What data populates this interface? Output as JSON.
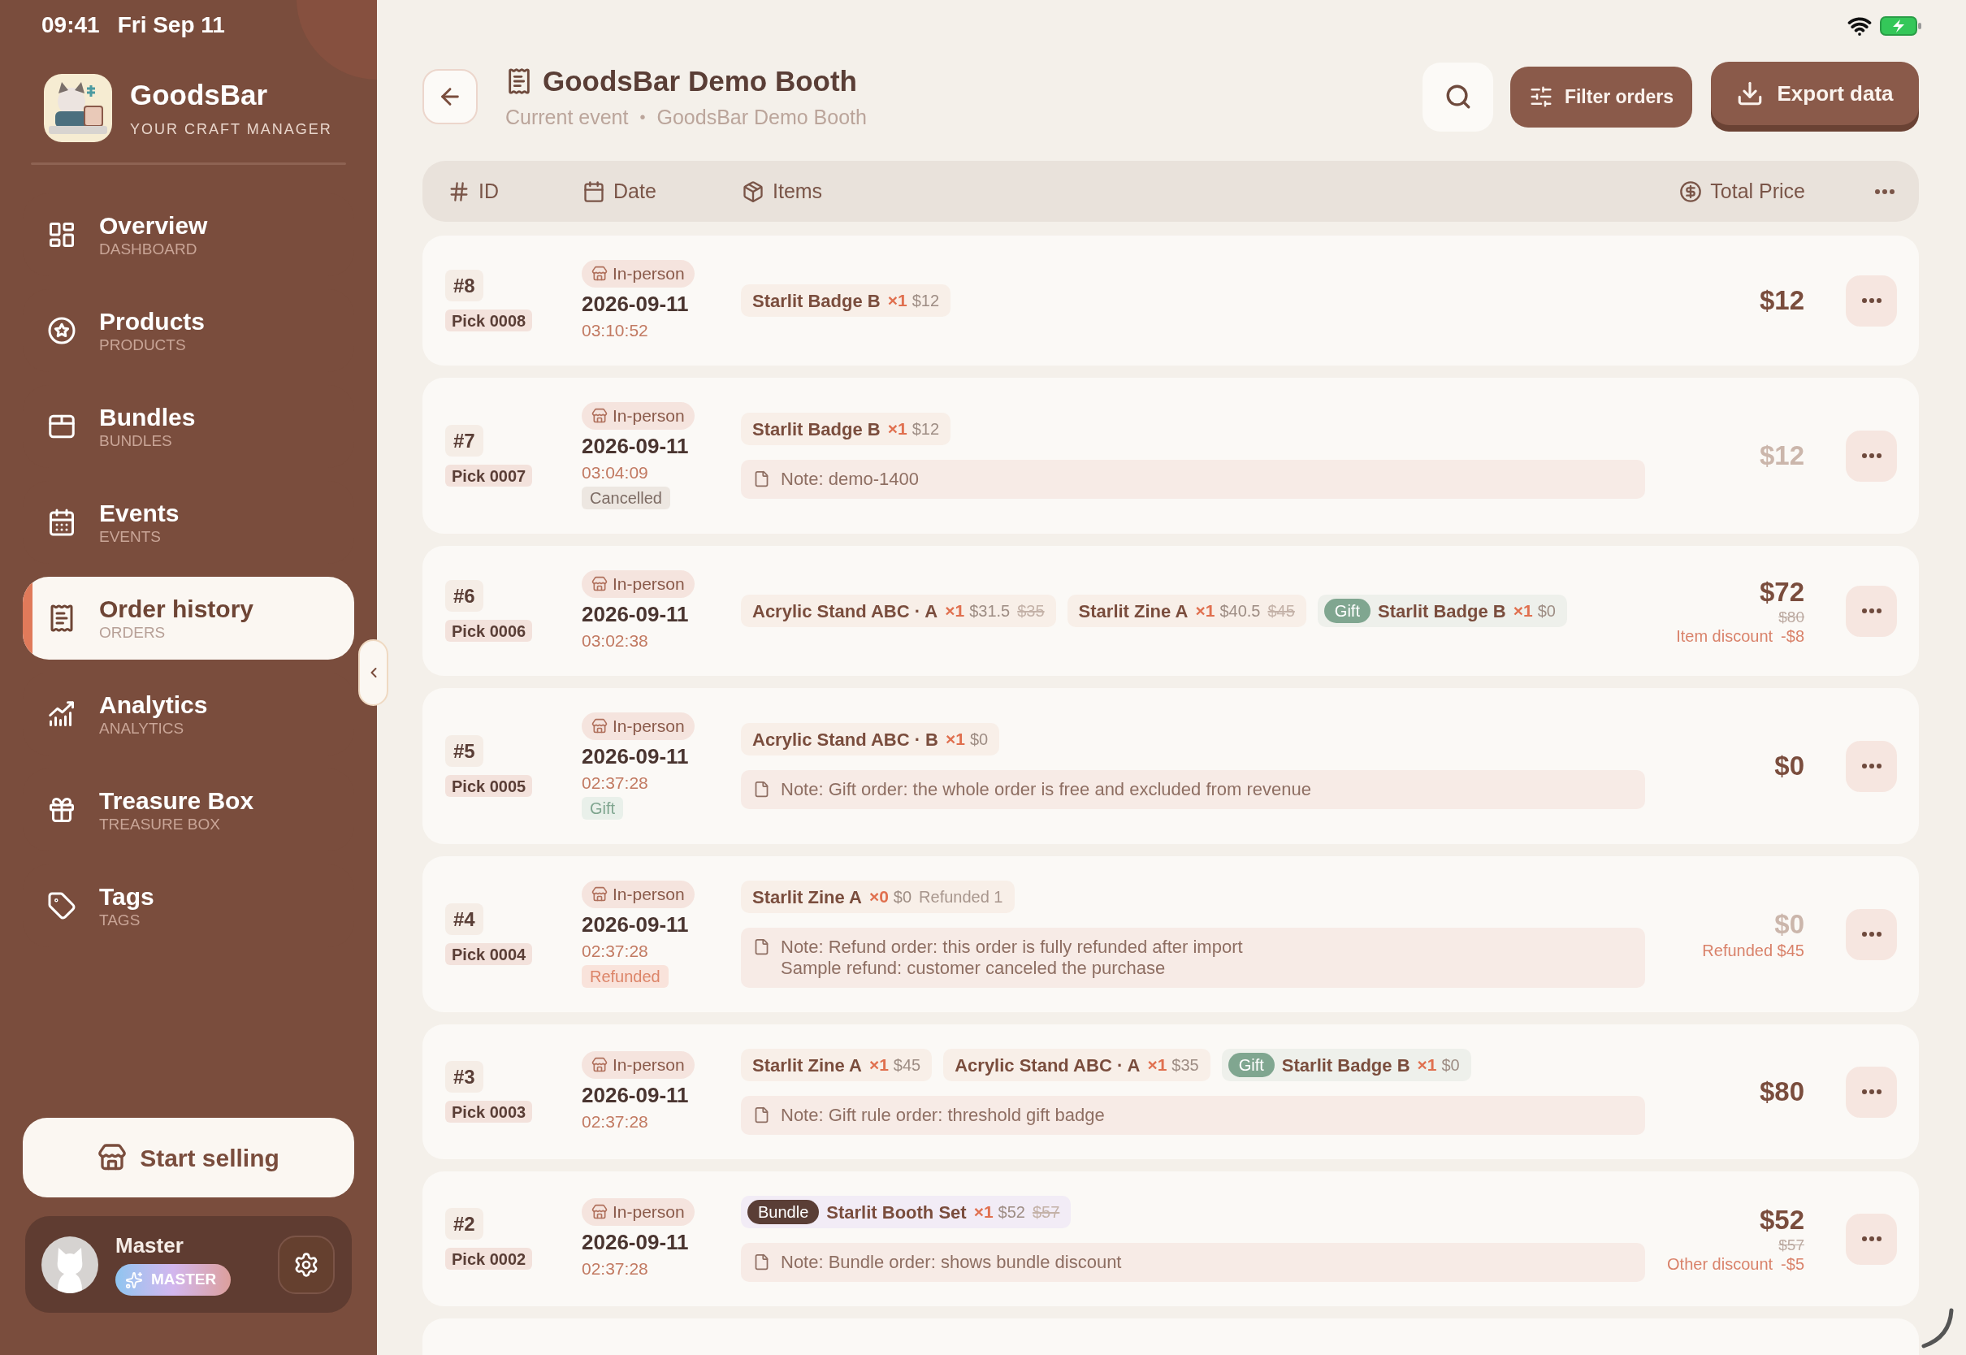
{
  "status_bar": {
    "time": "09:41",
    "date": "Fri Sep 11"
  },
  "brand": {
    "name": "GoodsBar",
    "tagline": "YOUR CRAFT MANAGER"
  },
  "nav": [
    {
      "label": "Overview",
      "sublabel": "DASHBOARD",
      "selected": false
    },
    {
      "label": "Products",
      "sublabel": "PRODUCTS",
      "selected": false
    },
    {
      "label": "Bundles",
      "sublabel": "BUNDLES",
      "selected": false
    },
    {
      "label": "Events",
      "sublabel": "EVENTS",
      "selected": false
    },
    {
      "label": "Order history",
      "sublabel": "ORDERS",
      "selected": true
    },
    {
      "label": "Analytics",
      "sublabel": "ANALYTICS",
      "selected": false
    },
    {
      "label": "Treasure Box",
      "sublabel": "TREASURE BOX",
      "selected": false
    },
    {
      "label": "Tags",
      "sublabel": "TAGS",
      "selected": false
    }
  ],
  "start_button": "Start selling",
  "profile": {
    "name": "Master",
    "role": "MASTER"
  },
  "header": {
    "title": "GoodsBar Demo Booth",
    "subtitle": {
      "label": "Current event",
      "separator": "•",
      "value": "GoodsBar Demo Booth"
    },
    "filter_button": "Filter orders",
    "export_button": "Export data"
  },
  "table": {
    "columns": [
      "ID",
      "Date",
      "Items",
      "Total Price"
    ],
    "rows": [
      {
        "number": "#8",
        "pick": "Pick 0008",
        "channel": "In-person",
        "date": "2026-09-11",
        "time": "03:10:52",
        "items": [
          {
            "name": "Starlit Badge B",
            "qty": "×1",
            "price": "$12"
          }
        ],
        "total": "$12",
        "total_dimmed": false
      },
      {
        "number": "#7",
        "pick": "Pick 0007",
        "channel": "In-person",
        "date": "2026-09-11",
        "time": "03:04:09",
        "status": {
          "kind": "cancelled",
          "label": "Cancelled"
        },
        "items": [
          {
            "name": "Starlit Badge B",
            "qty": "×1",
            "price": "$12"
          }
        ],
        "note_lines": [
          "Note: demo-1400"
        ],
        "total": "$12",
        "total_dimmed": true
      },
      {
        "number": "#6",
        "pick": "Pick 0006",
        "channel": "In-person",
        "date": "2026-09-11",
        "time": "03:02:38",
        "items": [
          {
            "name": "Acrylic Stand ABC · A",
            "qty": "×1",
            "price": "$31.5",
            "original_price": "$35"
          },
          {
            "name": "Starlit Zine A",
            "qty": "×1",
            "price": "$40.5",
            "original_price": "$45"
          },
          {
            "tag": {
              "kind": "gift",
              "label": "Gift"
            },
            "name": "Starlit Badge B",
            "qty": "×1",
            "price": "$0"
          }
        ],
        "total": "$72",
        "total_dimmed": false,
        "original_total": "$80",
        "adjustment": {
          "label": "Item discount",
          "amount": "-$8"
        }
      },
      {
        "number": "#5",
        "pick": "Pick 0005",
        "channel": "In-person",
        "date": "2026-09-11",
        "time": "02:37:28",
        "status": {
          "kind": "gift",
          "label": "Gift"
        },
        "items": [
          {
            "name": "Acrylic Stand ABC · B",
            "qty": "×1",
            "price": "$0"
          }
        ],
        "note_lines": [
          "Note: Gift order: the whole order is free and excluded from revenue"
        ],
        "total": "$0",
        "total_dimmed": false
      },
      {
        "number": "#4",
        "pick": "Pick 0004",
        "channel": "In-person",
        "date": "2026-09-11",
        "time": "02:37:28",
        "status": {
          "kind": "refunded",
          "label": "Refunded"
        },
        "items": [
          {
            "name": "Starlit Zine A",
            "qty": "×0",
            "price": "$0",
            "refunded": "Refunded 1"
          }
        ],
        "note_lines": [
          "Note: Refund order: this order is fully refunded after import",
          "Sample refund: customer canceled the purchase"
        ],
        "total": "$0",
        "total_dimmed": true,
        "adjustment": {
          "label": "Refunded $45"
        }
      },
      {
        "number": "#3",
        "pick": "Pick 0003",
        "channel": "In-person",
        "date": "2026-09-11",
        "time": "02:37:28",
        "items": [
          {
            "name": "Starlit Zine A",
            "qty": "×1",
            "price": "$45"
          },
          {
            "name": "Acrylic Stand ABC · A",
            "qty": "×1",
            "price": "$35"
          },
          {
            "tag": {
              "kind": "gift",
              "label": "Gift"
            },
            "name": "Starlit Badge B",
            "qty": "×1",
            "price": "$0"
          }
        ],
        "note_lines": [
          "Note: Gift rule order: threshold gift badge"
        ],
        "total": "$80",
        "total_dimmed": false
      },
      {
        "number": "#2",
        "pick": "Pick 0002",
        "channel": "In-person",
        "date": "2026-09-11",
        "time": "02:37:28",
        "items": [
          {
            "tag": {
              "kind": "bundle",
              "label": "Bundle"
            },
            "name": "Starlit Booth Set",
            "qty": "×1",
            "price": "$52",
            "original_price": "$57"
          }
        ],
        "note_lines": [
          "Note: Bundle order: shows bundle discount"
        ],
        "total": "$52",
        "total_dimmed": false,
        "original_total": "$57",
        "adjustment": {
          "label": "Other discount",
          "amount": "-$5"
        }
      }
    ]
  }
}
